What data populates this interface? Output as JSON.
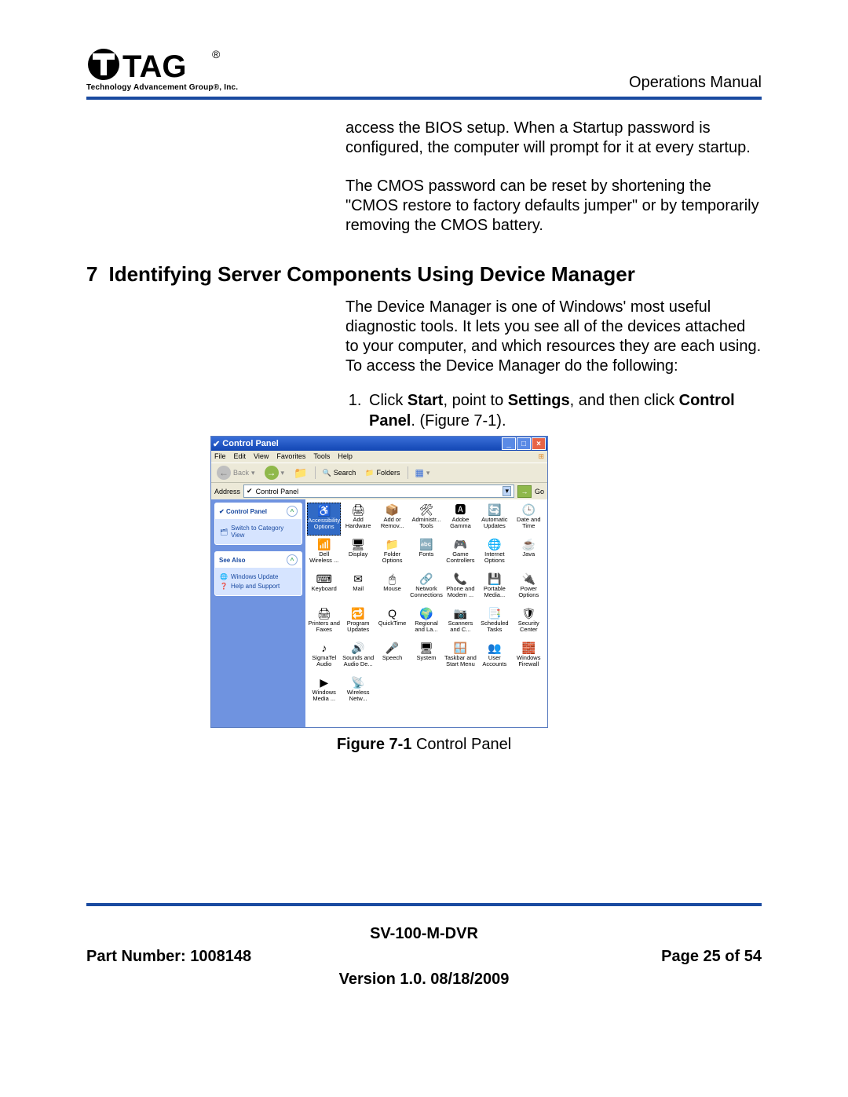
{
  "header": {
    "logo_text": "TAG",
    "logo_subtitle": "Technology Advancement Group®, Inc.",
    "manual": "Operations Manual"
  },
  "body": {
    "para1": "access the BIOS setup. When a Startup password is configured, the computer will prompt for it at every startup.",
    "para2": "The CMOS password can be reset by shortening the \"CMOS restore to factory defaults jumper\" or by temporarily removing the CMOS battery.",
    "section_num": "7",
    "section_title": "Identifying Server Components Using Device Manager",
    "para3": "The Device Manager is one of Windows' most useful diagnostic tools. It lets you see all of the devices attached to your computer, and which resources they are each using. To access the Device Manager do the following:",
    "step1_pre": "Click ",
    "step1_b1": "Start",
    "step1_mid1": ", point to ",
    "step1_b2": "Settings",
    "step1_mid2": ", and then click ",
    "step1_b3": "Control Panel",
    "step1_post": ". (Figure 7-1)."
  },
  "screenshot": {
    "title": "Control Panel",
    "menu": [
      "File",
      "Edit",
      "View",
      "Favorites",
      "Tools",
      "Help"
    ],
    "toolbar": {
      "back": "Back",
      "search": "Search",
      "folders": "Folders"
    },
    "address_label": "Address",
    "address_value": "Control Panel",
    "go": "Go",
    "side": {
      "panel1_title": "Control Panel",
      "panel1_link": "Switch to Category View",
      "panel2_title": "See Also",
      "panel2_links": [
        "Windows Update",
        "Help and Support"
      ]
    },
    "icons": [
      "Accessibility Options",
      "Add Hardware",
      "Add or Remov...",
      "Administr... Tools",
      "Adobe Gamma",
      "Automatic Updates",
      "Date and Time",
      "Dell Wireless ...",
      "Display",
      "Folder Options",
      "Fonts",
      "Game Controllers",
      "Internet Options",
      "Java",
      "Keyboard",
      "Mail",
      "Mouse",
      "Network Connections",
      "Phone and Modem ...",
      "Portable Media...",
      "Power Options",
      "Printers and Faxes",
      "Program Updates",
      "QuickTime",
      "Regional and La...",
      "Scanners and C...",
      "Scheduled Tasks",
      "Security Center",
      "SigmaTel Audio",
      "Sounds and Audio De...",
      "Speech",
      "System",
      "Taskbar and Start Menu",
      "User Accounts",
      "Windows Firewall",
      "Windows Media ...",
      "Wireless Netw..."
    ],
    "icon_glyphs": [
      "♿",
      "🖨",
      "📦",
      "🛠",
      "🅰",
      "🔄",
      "🕒",
      "📶",
      "🖥",
      "📁",
      "🔤",
      "🎮",
      "🌐",
      "☕",
      "⌨",
      "✉",
      "🖱",
      "🔗",
      "📞",
      "💾",
      "🔌",
      "🖨",
      "🔁",
      "Q",
      "🌍",
      "📷",
      "📑",
      "🛡",
      "♪",
      "🔊",
      "🎤",
      "🖥",
      "🪟",
      "👥",
      "🧱",
      "▶",
      "📡"
    ]
  },
  "figure_caption_bold": "Figure 7-1",
  "figure_caption_rest": " Control Panel",
  "footer": {
    "model": "SV-100-M-DVR",
    "part": "Part Number: 1008148",
    "page": "Page 25 of 54",
    "version": "Version 1.0. 08/18/2009"
  }
}
